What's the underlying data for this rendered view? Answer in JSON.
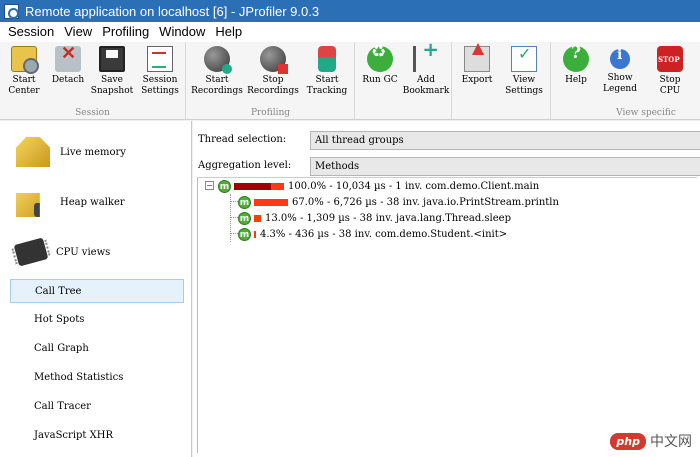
{
  "window": {
    "title": "Remote application on localhost [6] - JProfiler 9.0.3"
  },
  "menu": [
    "Session",
    "View",
    "Profiling",
    "Window",
    "Help"
  ],
  "toolbar": {
    "groups": {
      "session": "Session",
      "profiling": "Profiling",
      "view_specific": "View specific"
    },
    "buttons": {
      "start_center": "Start\nCenter",
      "detach": "Detach",
      "save_snapshot": "Save\nSnapshot",
      "session_settings": "Session\nSettings",
      "start_recordings": "Start\nRecordings",
      "stop_recordings": "Stop\nRecordings",
      "start_tracking": "Start\nTracking",
      "run_gc": "Run GC",
      "add_bookmark": "Add\nBookmark",
      "export": "Export",
      "view_settings": "View\nSettings",
      "help": "Help",
      "show_legend": "Show\nLegend",
      "stop_cpu": "Stop\nCPU"
    }
  },
  "sidebar": {
    "sections": {
      "live_memory": "Live memory",
      "heap_walker": "Heap walker",
      "cpu_views": "CPU views"
    },
    "items": [
      "Call Tree",
      "Hot Spots",
      "Call Graph",
      "Method Statistics",
      "Call Tracer",
      "JavaScript XHR"
    ],
    "selected": "Call Tree"
  },
  "options": {
    "thread_selection_label": "Thread selection:",
    "thread_selection_value": "All thread groups",
    "aggregation_label": "Aggregation level:",
    "aggregation_value": "Methods"
  },
  "call_tree": [
    {
      "badge": "m",
      "percent": 100.0,
      "bar_color": "#a00000",
      "text": "100.0% - 10,034 µs - 1 inv. com.demo.Client.main",
      "expanded": true
    },
    {
      "badge": "m",
      "percent": 67.0,
      "bar_color": "#ff3a10",
      "text": "67.0% - 6,726 µs - 38 inv. java.io.PrintStream.println"
    },
    {
      "badge": "m",
      "percent": 13.0,
      "bar_color": "#ff3a10",
      "text": "13.0% - 1,309 µs - 38 inv. java.lang.Thread.sleep"
    },
    {
      "badge": "m",
      "percent": 4.3,
      "bar_color": "#ff3a10",
      "text": "4.3% - 436 µs - 38 inv. com.demo.Student.<init>"
    }
  ],
  "watermark": {
    "logo": "php",
    "text": "中文网"
  }
}
